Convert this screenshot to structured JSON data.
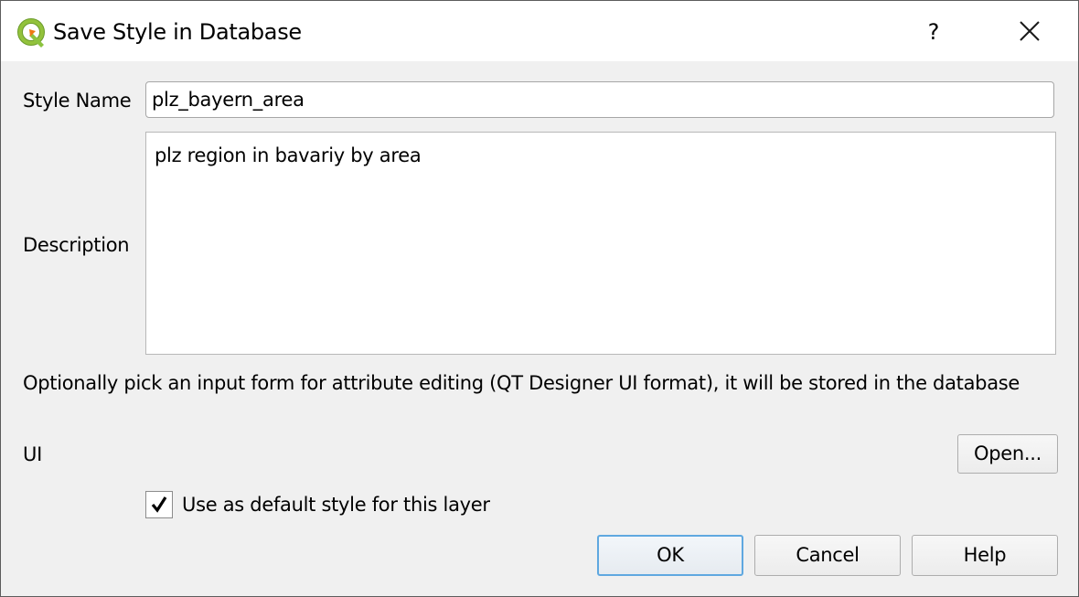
{
  "window": {
    "title": "Save Style in Database",
    "app_icon": "qgis-logo-icon",
    "help_label": "?",
    "close_icon": "close-icon"
  },
  "form": {
    "style_name_label": "Style Name",
    "style_name_value": "plz_bayern_area",
    "description_label": "Description",
    "description_value": "plz region in bavariy by area",
    "ui_hint": "Optionally pick an input form for attribute editing (QT Designer UI format), it will be stored in the database",
    "ui_label": "UI",
    "open_button": "Open...",
    "default_style_label": "Use as default style for this layer",
    "default_style_checked": true
  },
  "buttons": {
    "ok": "OK",
    "cancel": "Cancel",
    "help": "Help"
  },
  "colors": {
    "default_button_border": "#5fa8e0",
    "qgis_green": "#8cc33f",
    "qgis_orange": "#ee7913"
  }
}
